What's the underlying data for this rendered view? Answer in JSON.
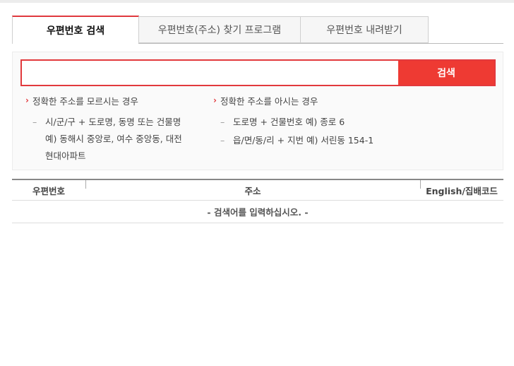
{
  "tabs": [
    {
      "label": "우편번호 검색",
      "active": true
    },
    {
      "label": "우편번호(주소) 찾기 프로그램",
      "active": false
    },
    {
      "label": "우편번호 내려받기",
      "active": false
    }
  ],
  "search": {
    "value": "",
    "placeholder": "",
    "button_label": "검색"
  },
  "help": {
    "left": {
      "heading": "정확한 주소를 모르시는 경우",
      "items": [
        "시/군/구 + 도로명, 동명 또는 건물명\n예) 동해시 중앙로, 여수 중앙동, 대전 현대아파트"
      ],
      "line1": "시/군/구 + 도로명, 동명 또는 건물명",
      "line2": "예) 동해시 중앙로, 여수 중앙동, 대전",
      "line3": "현대아파트"
    },
    "right": {
      "heading": "정확한 주소를 아시는 경우",
      "item1": "도로명 + 건물번호 예) 종로 6",
      "item2": "읍/면/동/리 + 지번 예) 서린동 154-1"
    }
  },
  "table": {
    "columns": [
      "우편번호",
      "주소",
      "English/집배코드"
    ],
    "empty_message": "- 검색어를 입력하십시오. -"
  },
  "colors": {
    "accent": "#e2393d",
    "button": "#ee3a33"
  },
  "icons": {
    "chevron": "chevron-right-icon",
    "dash": "dash-icon"
  }
}
